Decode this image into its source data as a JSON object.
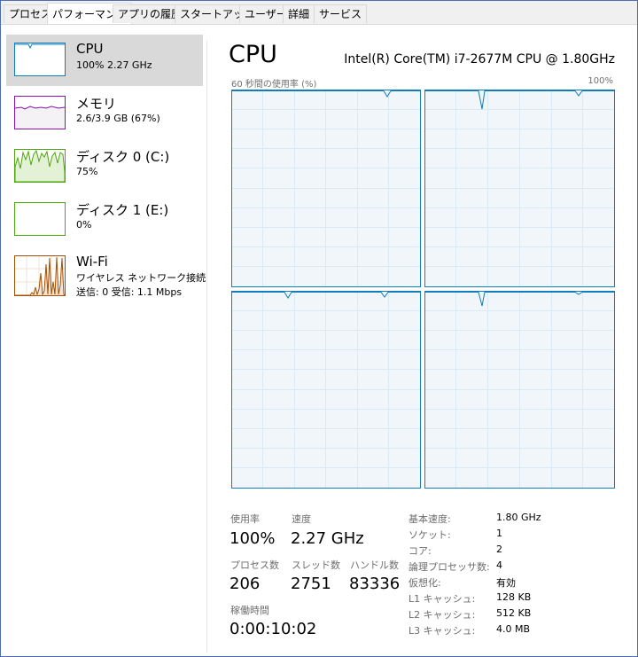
{
  "tabs": [
    {
      "label": "プロセス",
      "active": false
    },
    {
      "label": "パフォーマンス",
      "active": true
    },
    {
      "label": "アプリの履歴",
      "active": false
    },
    {
      "label": "スタートアップ",
      "active": false
    },
    {
      "label": "ユーザー",
      "active": false
    },
    {
      "label": "詳細",
      "active": false
    },
    {
      "label": "サービス",
      "active": false
    }
  ],
  "sidebar": {
    "items": [
      {
        "title": "CPU",
        "sub1": "100%  2.27 GHz",
        "sub2": "",
        "selected": true,
        "icon": "cpu-mini-graph"
      },
      {
        "title": "メモリ",
        "sub1": "2.6/3.9 GB (67%)",
        "sub2": "",
        "selected": false,
        "icon": "memory-mini-graph"
      },
      {
        "title": "ディスク 0 (C:)",
        "sub1": "75%",
        "sub2": "",
        "selected": false,
        "icon": "disk-mini-graph"
      },
      {
        "title": "ディスク 1 (E:)",
        "sub1": "0%",
        "sub2": "",
        "selected": false,
        "icon": "disk-mini-graph"
      },
      {
        "title": "Wi-Fi",
        "sub1": "ワイヤレス ネットワーク接続",
        "sub2": "送信: 0  受信: 1.1 Mbps",
        "selected": false,
        "icon": "wifi-mini-graph"
      }
    ]
  },
  "main": {
    "title": "CPU",
    "model": "Intel(R) Core(TM) i7-2677M CPU @ 1.80GHz",
    "graph_label_left": "60 秒間の使用率 (%)",
    "graph_label_right": "100%",
    "stats": {
      "usage_label": "使用率",
      "usage_value": "100%",
      "speed_label": "速度",
      "speed_value": "2.27 GHz",
      "process_label": "プロセス数",
      "process_value": "206",
      "thread_label": "スレッド数",
      "thread_value": "2751",
      "handle_label": "ハンドル数",
      "handle_value": "83336",
      "uptime_label": "稼働時間",
      "uptime_value": "0:00:10:02"
    },
    "specs": [
      {
        "label": "基本速度:",
        "value": "1.80 GHz"
      },
      {
        "label": "ソケット:",
        "value": "1"
      },
      {
        "label": "コア:",
        "value": "2"
      },
      {
        "label": "論理プロセッサ数:",
        "value": "4"
      },
      {
        "label": "仮想化:",
        "value": "有効"
      },
      {
        "label": "L1 キャッシュ:",
        "value": "128 KB"
      },
      {
        "label": "L2 キャッシュ:",
        "value": "512 KB"
      },
      {
        "label": "L3 キャッシュ:",
        "value": "4.0 MB"
      }
    ]
  },
  "colors": {
    "cpu": "#117dbb",
    "memory": "#8b12ae",
    "disk": "#4da60c",
    "wifi": "#a74f01",
    "graph_fill": "#f1f6fa",
    "grid": "#d9eaf4"
  }
}
